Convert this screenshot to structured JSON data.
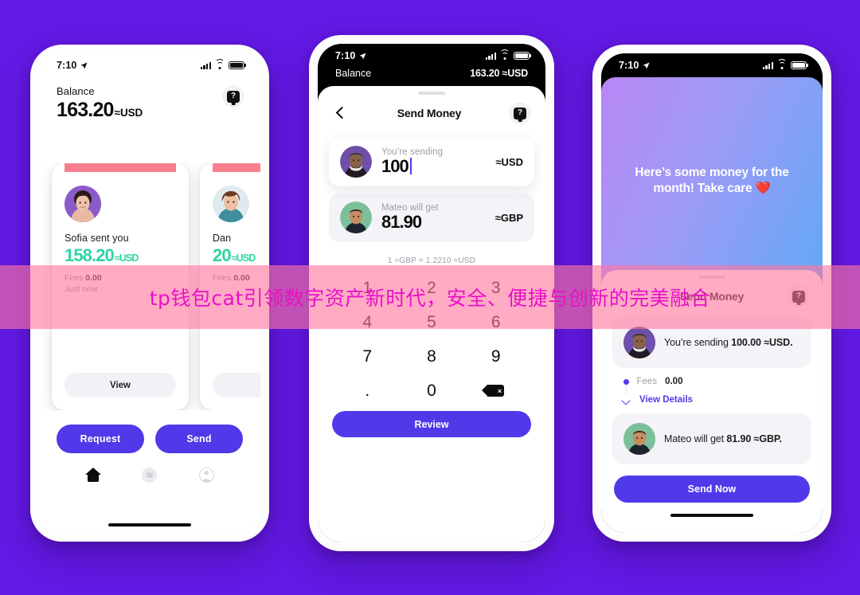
{
  "background_color": "#6419E5",
  "overlay": {
    "text": "tp钱包cat引领数字资产新时代，安全、便捷与创新的完美融合",
    "background": "rgba(255,120,160,0.62)",
    "text_color": "#E910C8"
  },
  "phone1": {
    "status": {
      "time": "7:10"
    },
    "balance_label": "Balance",
    "balance_amount": "163.20",
    "balance_currency": "USD",
    "help_glyph": "?",
    "cards": [
      {
        "name": "Sofia sent you",
        "amount": "158.20",
        "currency": "USD",
        "fees_label": "Fees",
        "fees_value": "0.00",
        "time": "Just now",
        "action": "View"
      },
      {
        "name": "Dan",
        "amount": "20",
        "currency": "USD",
        "fees_label": "Fees",
        "fees_value": "0.00",
        "time": "",
        "action": ""
      }
    ],
    "actions": {
      "request": "Request",
      "send": "Send"
    },
    "tabbar": [
      {
        "icon": "home-icon",
        "active": true
      },
      {
        "icon": "diem-wave-icon",
        "active": false
      },
      {
        "icon": "profile-icon",
        "active": false
      }
    ]
  },
  "phone2": {
    "status": {
      "time": "7:10"
    },
    "balance_label": "Balance",
    "balance_amount": "163.20",
    "balance_currency": "USD",
    "title": "Send Money",
    "help_glyph": "?",
    "sending": {
      "caption": "You’re sending",
      "value": "100",
      "currency": "USD"
    },
    "receiving": {
      "caption": "Mateo will get",
      "value": "81.90",
      "currency": "GBP"
    },
    "rate": "1 ≈GBP = 1.2210 ≈USD",
    "keypad": [
      "1",
      "2",
      "3",
      "4",
      "5",
      "6",
      "7",
      "8",
      "9",
      ".",
      "0",
      "backspace"
    ],
    "review_button": "Review"
  },
  "phone3": {
    "status": {
      "time": "7:10"
    },
    "message": "Here’s some money for the month! Take care ❤️",
    "title": "Send Money",
    "help_glyph": "?",
    "summary_send_prefix": "You’re sending ",
    "summary_send_amount": "100.00 ≈USD.",
    "fees_label": "Fees",
    "fees_value": "0.00",
    "view_details": "View Details",
    "summary_get_prefix": "Mateo will get ",
    "summary_get_amount": "81.90 ≈GBP.",
    "send_now_button": "Send Now"
  }
}
